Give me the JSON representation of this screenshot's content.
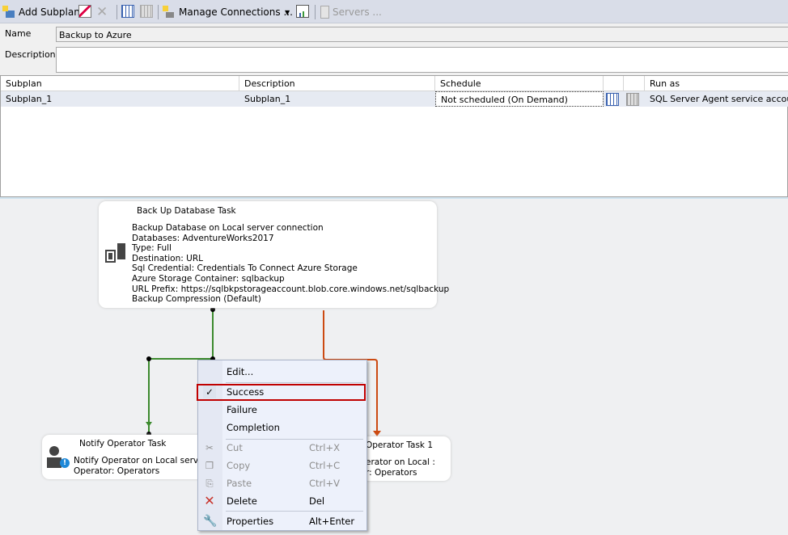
{
  "toolbar": {
    "add_subplan": "Add Subplan",
    "manage_connections": "Manage Connections ...",
    "servers": "Servers ..."
  },
  "form": {
    "name_label": "Name",
    "name_value": "Backup to Azure",
    "description_label": "Description",
    "description_value": ""
  },
  "grid": {
    "headers": [
      "Subplan",
      "Description",
      "Schedule",
      "Run as"
    ],
    "rows": [
      {
        "subplan": "Subplan_1",
        "description": "Subplan_1",
        "schedule": "Not scheduled (On Demand)",
        "run_as": "SQL Server Agent service account"
      }
    ]
  },
  "tasks": {
    "backup": {
      "title": "Back Up Database Task",
      "lines": [
        "Backup Database on Local server connection",
        "Databases: AdventureWorks2017",
        "Type: Full",
        "Destination: URL",
        "Sql Credential: Credentials To Connect Azure Storage",
        "Azure Storage Container: sqlbackup",
        "URL Prefix: https://sqlbkpstorageaccount.blob.core.windows.net/sqlbackup",
        "Backup Compression (Default)"
      ]
    },
    "notify": {
      "title": "Notify Operator Task",
      "lines": [
        "Notify Operator on Local server",
        "Operator: Operators"
      ]
    },
    "notify1": {
      "title": "Operator Task 1",
      "lines": [
        "erator on Local :",
        "r: Operators"
      ]
    }
  },
  "context_menu": {
    "items": [
      {
        "label": "Edit..."
      },
      {
        "label": "Success",
        "checked": true
      },
      {
        "label": "Failure"
      },
      {
        "label": "Completion"
      },
      {
        "label": "Cut",
        "shortcut": "Ctrl+X",
        "disabled": true
      },
      {
        "label": "Copy",
        "shortcut": "Ctrl+C",
        "disabled": true
      },
      {
        "label": "Paste",
        "shortcut": "Ctrl+V",
        "disabled": true
      },
      {
        "label": "Delete",
        "shortcut": "Del"
      },
      {
        "label": "Properties",
        "shortcut": "Alt+Enter"
      }
    ],
    "check_glyph": "✓"
  },
  "colors": {
    "success": "#3c8a2e",
    "completion": "#cc4a12",
    "highlight": "#c00000"
  }
}
